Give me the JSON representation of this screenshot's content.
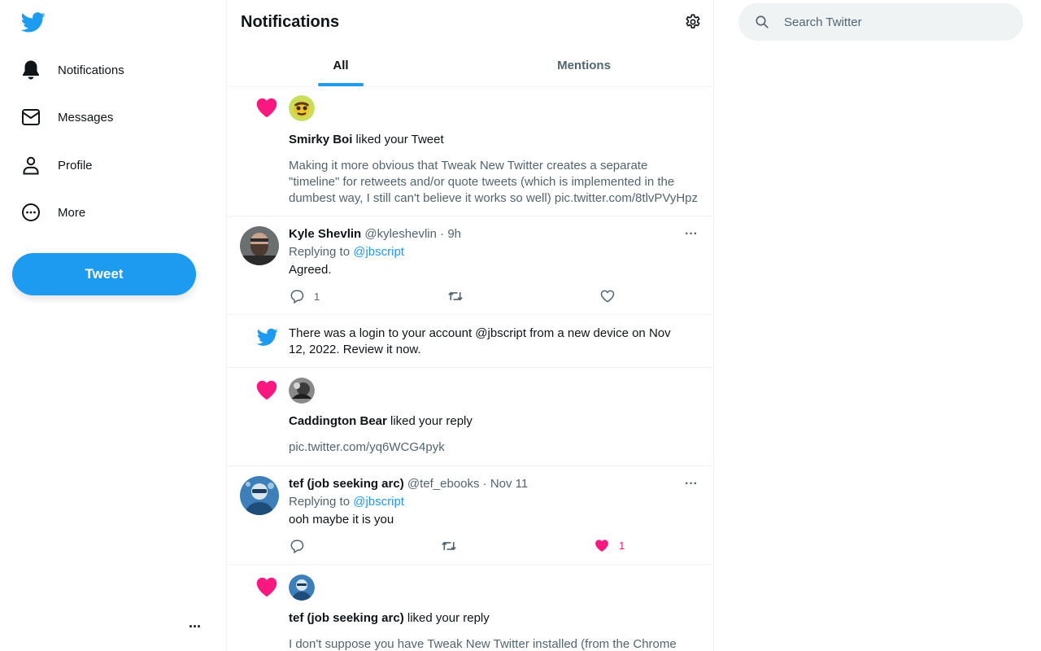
{
  "sidebar": {
    "items": [
      {
        "label": "Notifications",
        "icon": "bell-icon"
      },
      {
        "label": "Messages",
        "icon": "envelope-icon"
      },
      {
        "label": "Profile",
        "icon": "person-icon"
      },
      {
        "label": "More",
        "icon": "more-circle-icon"
      }
    ],
    "tweet_label": "Tweet",
    "account_more": "..."
  },
  "header": {
    "title": "Notifications",
    "tabs": [
      {
        "label": "All",
        "active": true
      },
      {
        "label": "Mentions",
        "active": false
      }
    ]
  },
  "notifications": [
    {
      "type": "like",
      "name": "Smirky Boi",
      "action": "liked your Tweet",
      "text_lines": [
        "Making it more obvious that Tweak New Twitter creates a separate",
        "\"timeline\" for retweets and/or quote tweets (which is implemented in the",
        "dumbest way, I still can't believe it works so well) pic.twitter.com/8tlvPVyHpz"
      ]
    },
    {
      "type": "reply",
      "name": "Kyle Shevlin",
      "handle": "@kyleshevlin",
      "time": "9h",
      "replying_prefix": "Replying to",
      "replying_to": "@jbscript",
      "text": "Agreed.",
      "reply_count": "1",
      "retweet_count": "",
      "like_count": ""
    },
    {
      "type": "security",
      "text_lines": [
        "There was a login to your account @jbscript from a new device on Nov",
        "12, 2022. Review it now."
      ]
    },
    {
      "type": "like",
      "name": "Caddington Bear",
      "action": "liked your reply",
      "text": "pic.twitter.com/yq6WCG4pyk"
    },
    {
      "type": "reply",
      "name": "tef (job seeking arc)",
      "handle": "@tef_ebooks",
      "time": "Nov 11",
      "replying_prefix": "Replying to",
      "replying_to": "@jbscript",
      "text": "ooh maybe it is you",
      "reply_count": "",
      "retweet_count": "",
      "like_count": "1"
    },
    {
      "type": "like",
      "name": "tef (job seeking arc)",
      "action": "liked your reply",
      "text": "I don't suppose you have Tweak New Twitter installed (from the Chrome"
    }
  ],
  "search": {
    "placeholder": "Search Twitter"
  },
  "colors": {
    "brand": "#1d9bf0",
    "like": "#f91880",
    "text": "#0f1419",
    "secondary": "#536471"
  }
}
